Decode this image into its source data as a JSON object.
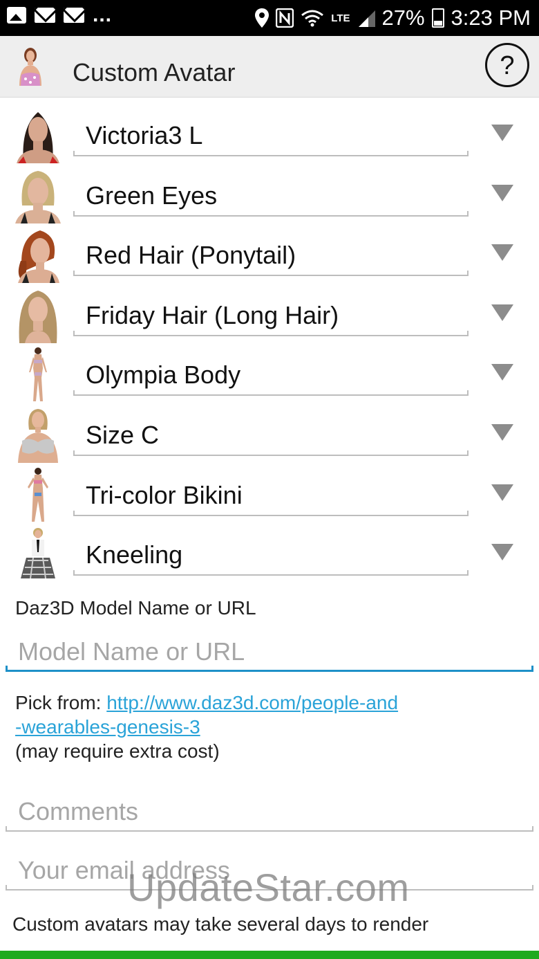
{
  "status_bar": {
    "battery": "27%",
    "time": "3:23 PM",
    "network": "LTE",
    "overflow": "...",
    "icons": [
      "image-icon",
      "mail-icon",
      "mail-icon",
      "location-icon",
      "nfc-icon",
      "wifi-icon",
      "signal-icon",
      "battery-icon"
    ]
  },
  "app_bar": {
    "title": "Custom Avatar",
    "help_label": "?"
  },
  "rows": [
    {
      "label": "Victoria3 L",
      "thumb": "face-dark-hair"
    },
    {
      "label": "Green Eyes",
      "thumb": "face-blonde"
    },
    {
      "label": "Red Hair (Ponytail)",
      "thumb": "face-red-hair"
    },
    {
      "label": "Friday Hair (Long Hair)",
      "thumb": "face-long-hair"
    },
    {
      "label": "Olympia Body",
      "thumb": "full-body"
    },
    {
      "label": "Size C",
      "thumb": "torso"
    },
    {
      "label": "Tri-color Bikini",
      "thumb": "full-body-bikini"
    },
    {
      "label": "Kneeling",
      "thumb": "kneeling-pose"
    }
  ],
  "model": {
    "label": "Daz3D Model Name or URL",
    "placeholder": "Model Name or URL",
    "value": ""
  },
  "pick": {
    "prefix": "Pick from: ",
    "link_line1": "http://www.daz3d.com/people-and",
    "link_line2": "-wearables-genesis-3",
    "note": "(may require extra cost)"
  },
  "comments": {
    "placeholder": "Comments",
    "value": ""
  },
  "email": {
    "placeholder": "Your email address",
    "value": ""
  },
  "footnote": "Custom avatars may take several days to render",
  "watermark": "UpdateStar.com",
  "colors": {
    "accent_blue": "#1e90c8",
    "link": "#2aa3d8",
    "green_bar": "#1faa1f",
    "arrow": "#8c8c8c"
  }
}
